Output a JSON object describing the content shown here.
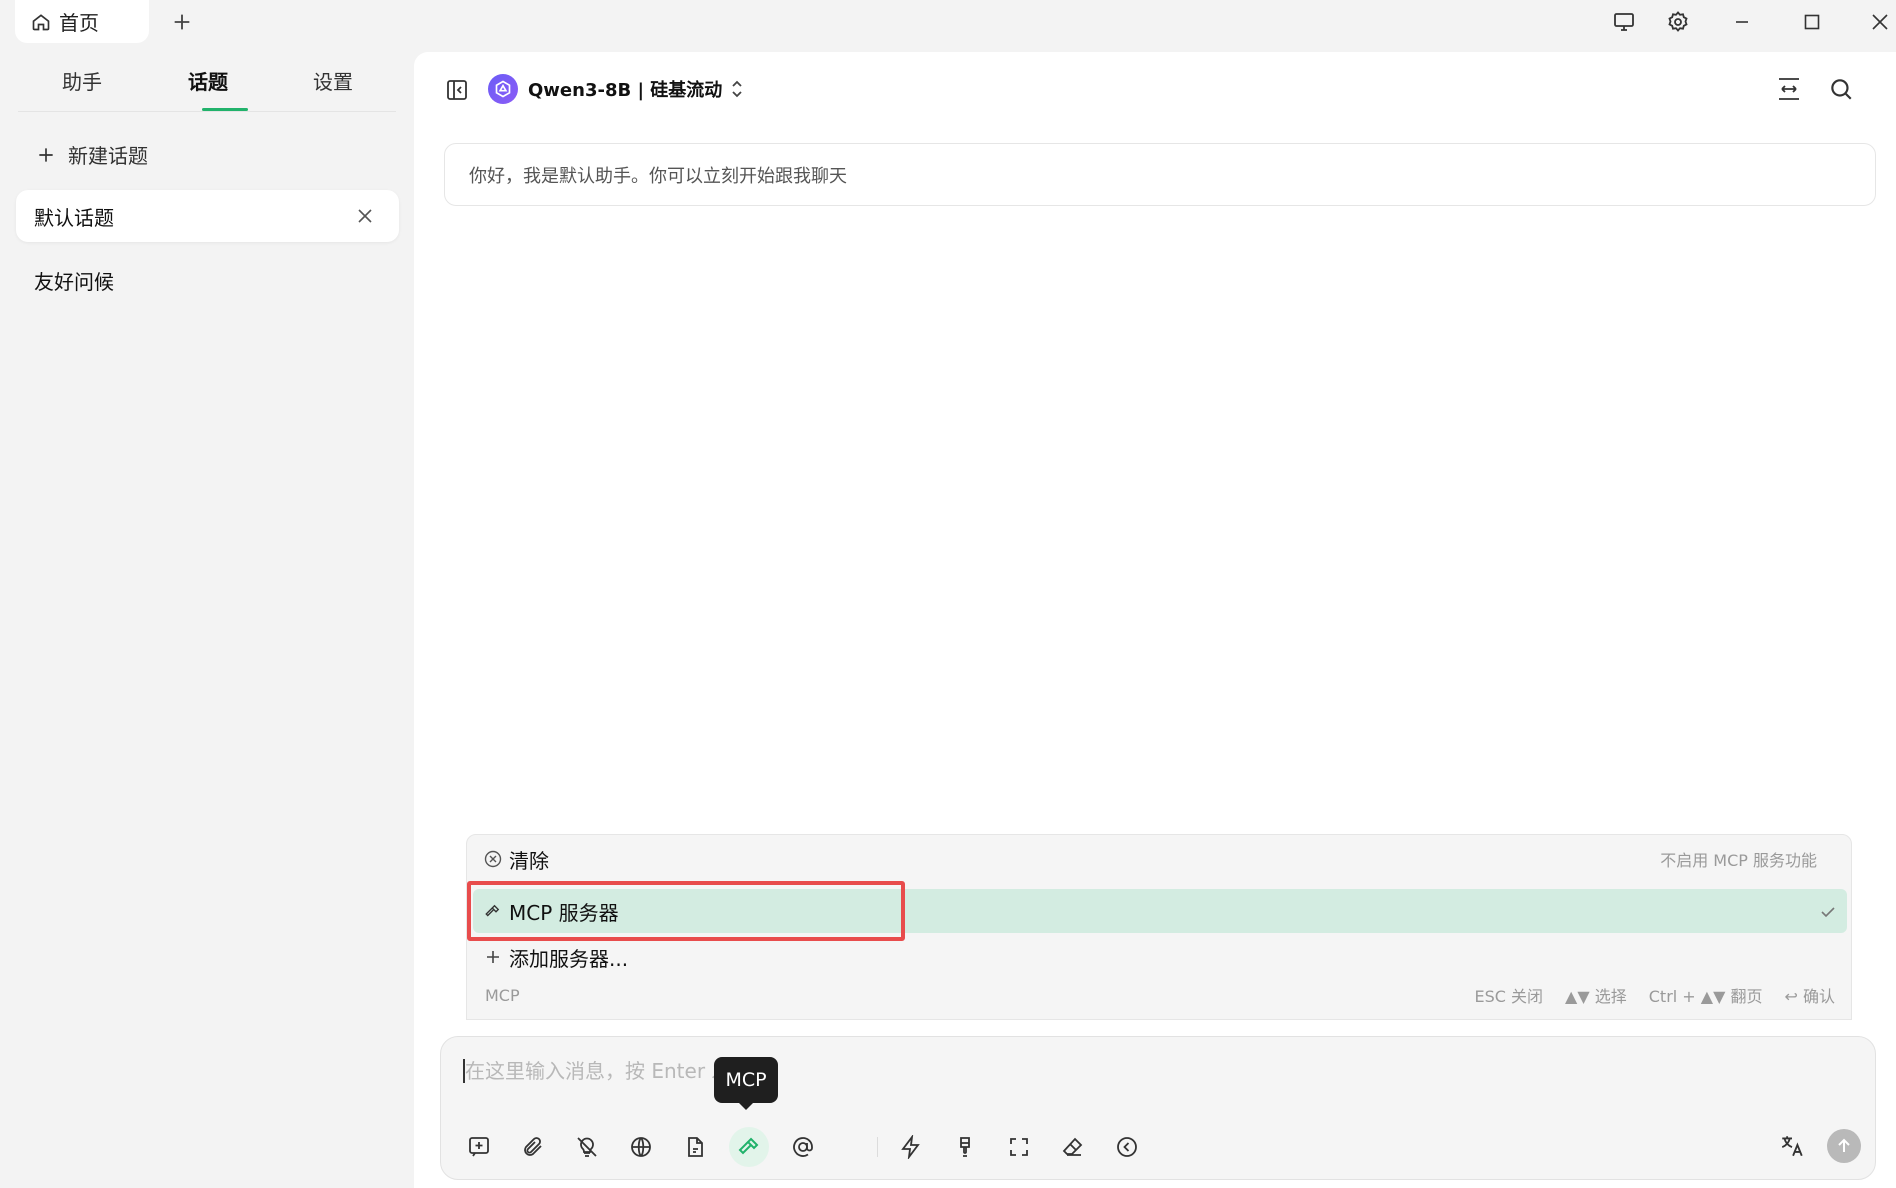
{
  "window": {
    "home_tab_label": "首页",
    "icons": [
      "home-icon",
      "plus-icon",
      "monitor-icon",
      "gear-icon",
      "minimize-icon",
      "maximize-icon",
      "close-icon"
    ]
  },
  "sidebar": {
    "tabs": [
      {
        "label": "助手",
        "active": false
      },
      {
        "label": "话题",
        "active": true
      },
      {
        "label": "设置",
        "active": false
      }
    ],
    "new_topic_label": "新建话题",
    "topics": [
      {
        "label": "默认话题",
        "active": true
      },
      {
        "label": "友好问候",
        "active": false
      }
    ]
  },
  "header": {
    "model_name": "Qwen3-8B | 硅基流动"
  },
  "chat": {
    "greeting": "你好，我是默认助手。你可以立刻开始跟我聊天"
  },
  "mcp_popup": {
    "items": [
      {
        "label": "清除",
        "hint": "不启用 MCP 服务功能",
        "icon": "clear-circle-icon",
        "selected": false
      },
      {
        "label": "MCP 服务器",
        "hint": "",
        "icon": "hammer-icon",
        "selected": true
      },
      {
        "label": "添加服务器...",
        "hint": "",
        "icon": "plus-icon",
        "selected": false
      }
    ],
    "footer_label": "MCP",
    "footer_keys": [
      "ESC 关闭",
      "▲▼ 选择",
      "Ctrl + ▲▼ 翻页",
      "↩ 确认"
    ]
  },
  "input": {
    "value": "",
    "placeholder": "在这里输入消息，按 Enter 发送",
    "tooltip": "MCP"
  },
  "colors": {
    "accent": "#21b26b",
    "selected_row": "#d3ece1",
    "highlight_box": "#e84c4c"
  }
}
